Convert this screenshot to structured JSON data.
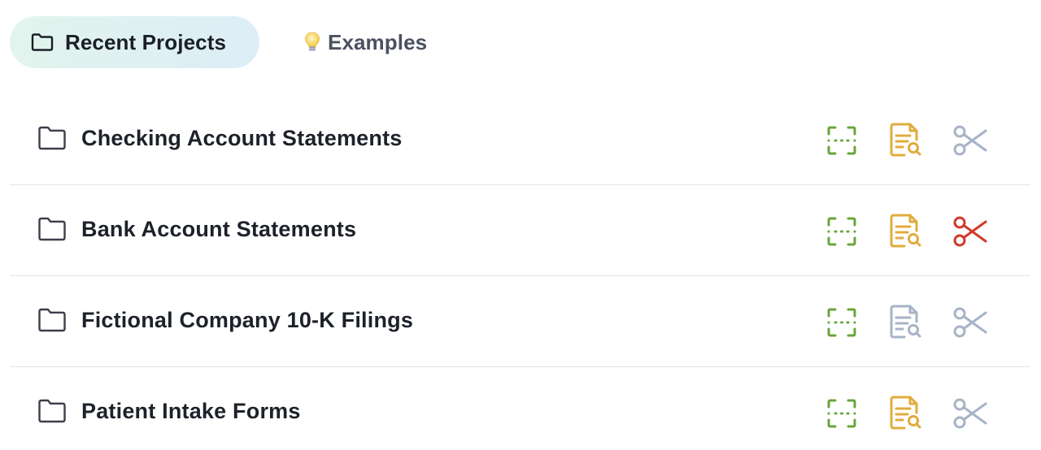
{
  "tabs": [
    {
      "label": "Recent Projects",
      "icon": "folder-icon",
      "active": true
    },
    {
      "label": "Examples",
      "icon": "lightbulb-icon",
      "active": false
    }
  ],
  "projects": [
    {
      "name": "Checking Account Statements",
      "actions": {
        "extract": "active",
        "review": "active",
        "split": "inactive"
      }
    },
    {
      "name": "Bank Account Statements",
      "actions": {
        "extract": "active",
        "review": "active",
        "split": "alert"
      }
    },
    {
      "name": "Fictional Company 10-K Filings",
      "actions": {
        "extract": "active",
        "review": "inactive",
        "split": "inactive"
      }
    },
    {
      "name": "Patient Intake Forms",
      "actions": {
        "extract": "active",
        "review": "active",
        "split": "inactive"
      }
    }
  ],
  "colors": {
    "extract_active": "#6aa53a",
    "review_active": "#e0ac3c",
    "split_alert": "#d13a2b",
    "inactive": "#a7b3c7",
    "tab_gradient_start": "#e2f4ec",
    "tab_gradient_end": "#dcedf7"
  }
}
